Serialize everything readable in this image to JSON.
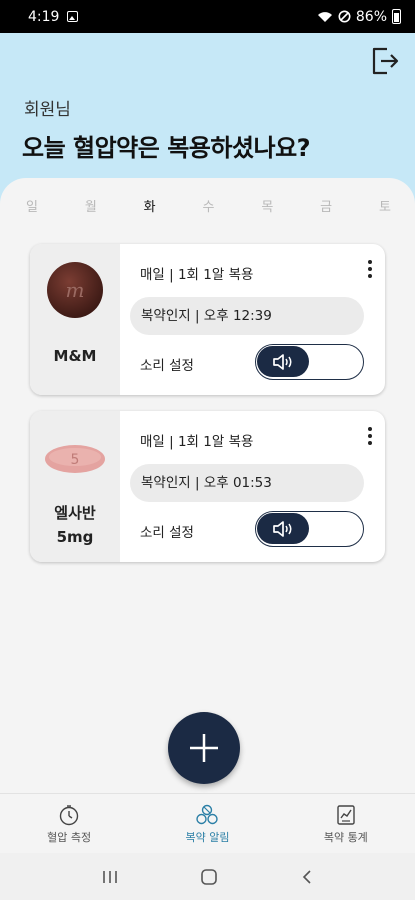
{
  "status": {
    "time": "4:19",
    "battery": "86%"
  },
  "header": {
    "member": "회원님",
    "title": "오늘 혈압약은 복용하셨나요?"
  },
  "weekdays": [
    {
      "label": "일",
      "active": false
    },
    {
      "label": "월",
      "active": false
    },
    {
      "label": "화",
      "active": true
    },
    {
      "label": "수",
      "active": false
    },
    {
      "label": "목",
      "active": false
    },
    {
      "label": "금",
      "active": false
    },
    {
      "label": "토",
      "active": false
    }
  ],
  "cards": [
    {
      "name_line1": "M&M",
      "name_line2": "",
      "frequency": "매일 | 1회 1알 복용",
      "reminder": "복약인지 | 오후 12:39",
      "sound_label": "소리 설정",
      "pill_color": "#5a2a22"
    },
    {
      "name_line1": "엘사반",
      "name_line2": "5mg",
      "frequency": "매일 | 1회 1알 복용",
      "reminder": "복약인지 | 오후 01:53",
      "sound_label": "소리 설정",
      "pill_color": "#e4a3a0",
      "pill_text": "5"
    }
  ],
  "nav": {
    "items": [
      {
        "label": "혈압 측정",
        "icon": "stopwatch-icon",
        "active": false
      },
      {
        "label": "복약 알림",
        "icon": "pills-icon",
        "active": true
      },
      {
        "label": "복약 통계",
        "icon": "chart-icon",
        "active": false
      }
    ]
  },
  "colors": {
    "header_bg": "#c6e8f7",
    "accent": "#1b2a44",
    "active_nav": "#2b7fa6"
  }
}
